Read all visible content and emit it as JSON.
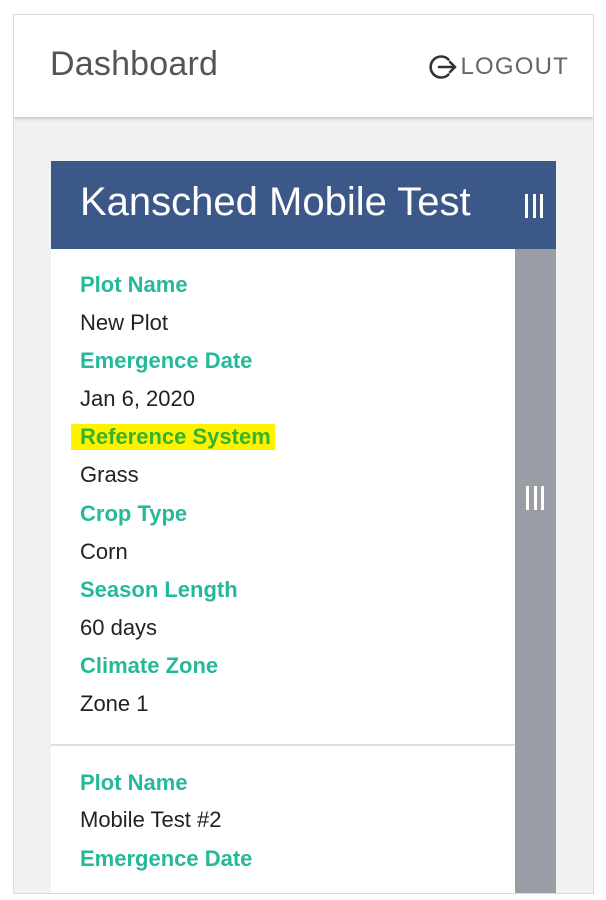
{
  "header": {
    "title": "Dashboard",
    "logout_label": "LOGOUT",
    "logout_icon": "logout-icon"
  },
  "card": {
    "title": "Kansched Mobile Test",
    "plots": [
      {
        "fields": [
          {
            "label": "Plot Name",
            "value": "New Plot"
          },
          {
            "label": "Emergence Date",
            "value": "Jan 6, 2020"
          },
          {
            "label": "Reference System",
            "value": "Grass"
          },
          {
            "label": "Crop Type",
            "value": "Corn"
          },
          {
            "label": "Season Length",
            "value": "60 days"
          },
          {
            "label": "Climate Zone",
            "value": "Zone 1"
          }
        ]
      },
      {
        "fields": [
          {
            "label": "Plot Name",
            "value": "Mobile Test #2"
          },
          {
            "label": "Emergence Date",
            "value": ""
          }
        ]
      }
    ]
  },
  "colors": {
    "card_header": "#3b5889",
    "label": "#25b99a",
    "highlight": "#fff200",
    "scrollbar": "#9a9ca6"
  }
}
